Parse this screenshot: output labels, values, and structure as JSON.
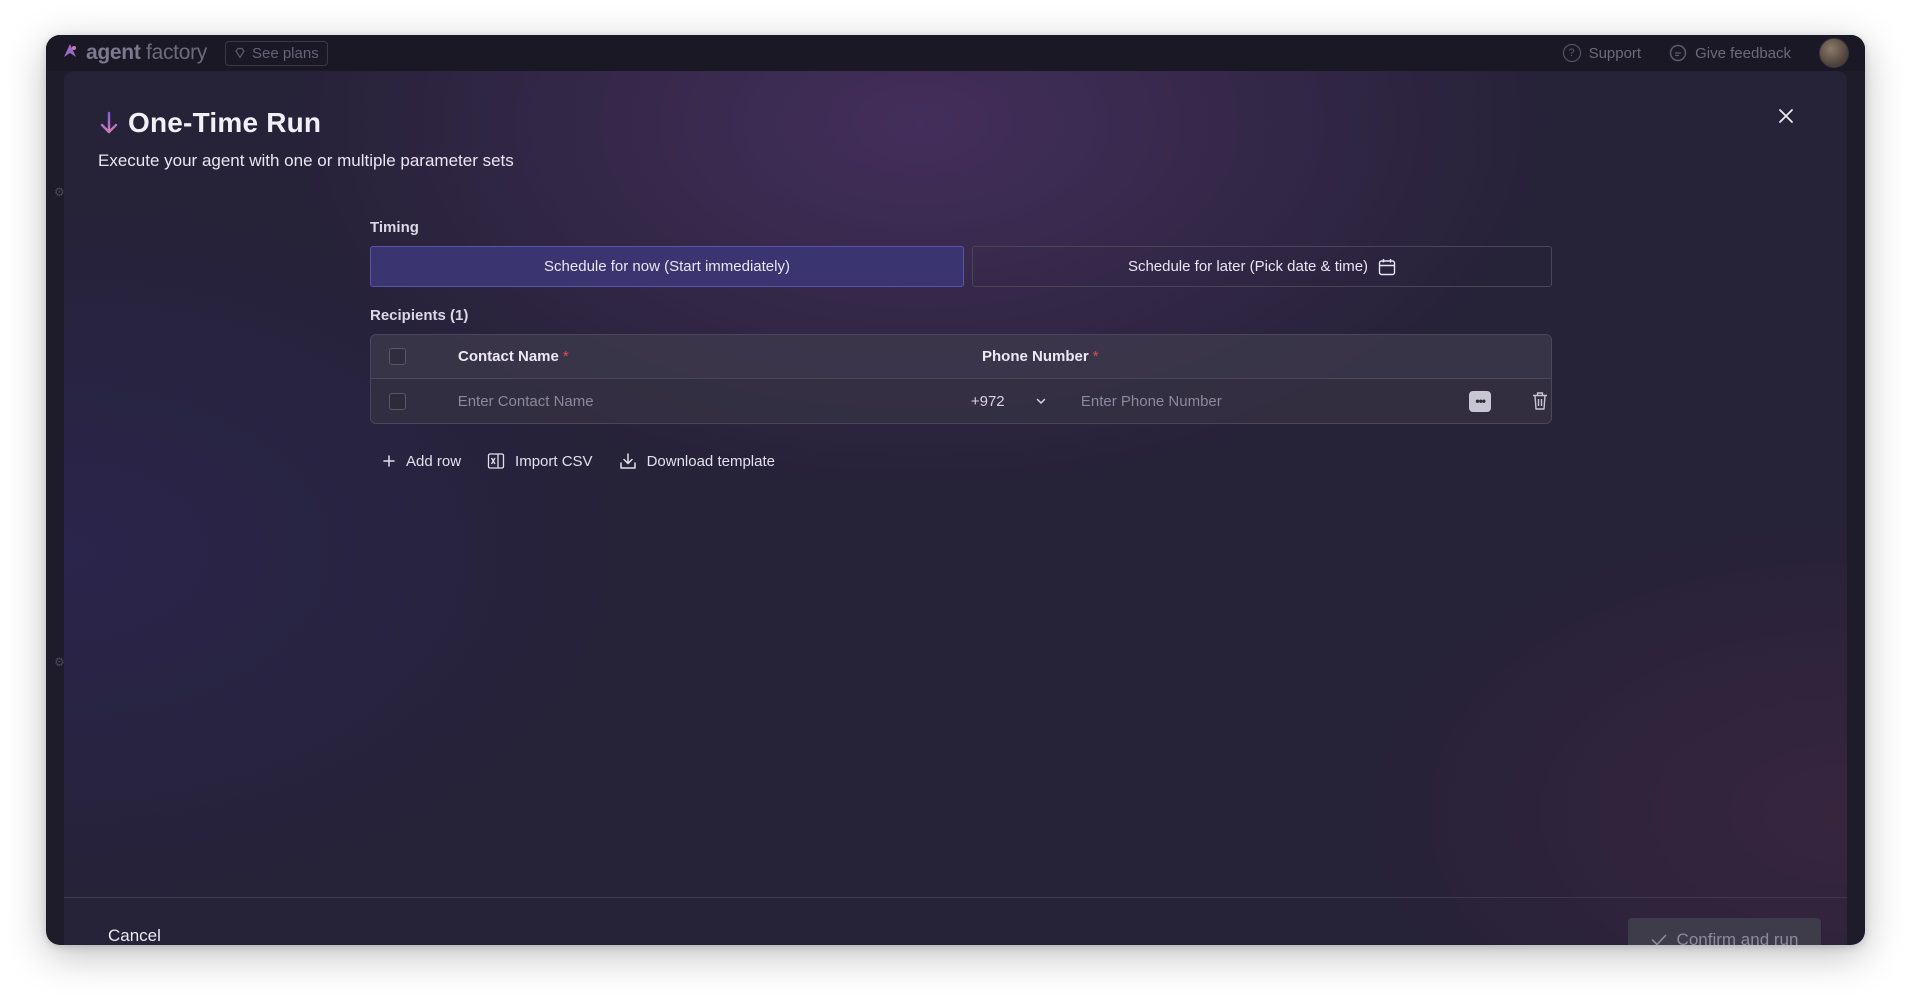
{
  "topbar": {
    "brand_bold": "agent",
    "brand_light": " factory",
    "see_plans": "See plans",
    "support": "Support",
    "give_feedback": "Give feedback"
  },
  "modal": {
    "title": "One-Time Run",
    "subtitle": "Execute your agent with one or multiple parameter sets"
  },
  "timing": {
    "label": "Timing",
    "now_label": "Schedule for now (Start immediately)",
    "later_label": "Schedule for later (Pick date & time)",
    "selected": "now"
  },
  "recipients": {
    "label": "Recipients (1)",
    "columns": {
      "contact_name": "Contact Name",
      "phone_number": "Phone Number",
      "required_mark": "*"
    },
    "rows": [
      {
        "contact_placeholder": "Enter Contact Name",
        "country_code": "+972",
        "phone_placeholder": "Enter Phone Number"
      }
    ]
  },
  "actions": {
    "add_row": "Add row",
    "import_csv": "Import CSV",
    "download_template": "Download template"
  },
  "footer": {
    "cancel": "Cancel",
    "confirm": "Confirm and run"
  },
  "colors": {
    "accent_selected": "#3a3570",
    "accent_border": "#5a55a8",
    "required": "#e5484d",
    "title_arrow": "#a77ee8"
  }
}
